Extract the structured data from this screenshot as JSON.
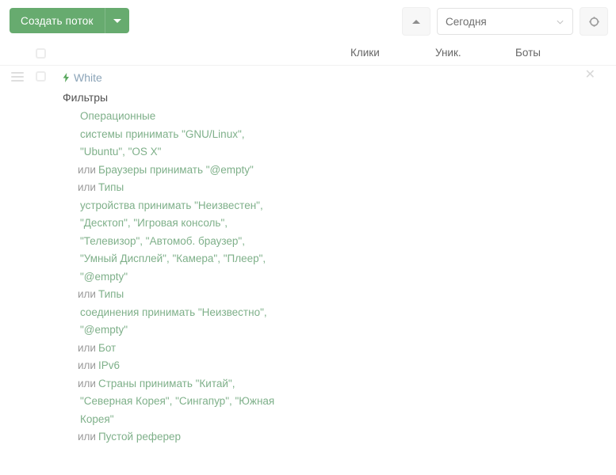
{
  "toolbar": {
    "create_button_label": "Создать поток",
    "create_button_caret_icon": "chevron-down-icon",
    "collapse_button_icon": "chevron-up-icon",
    "refresh_button_icon": "refresh-icon",
    "date_filter": {
      "selected": "Сегодня",
      "chevron_icon": "chevron-down-icon"
    }
  },
  "table": {
    "select_all_checkbox": "unchecked",
    "columns": [
      {
        "label": "Клики"
      },
      {
        "label": "Уник."
      },
      {
        "label": "Боты"
      }
    ]
  },
  "row": {
    "drag_handle_icon": "drag-handle-icon",
    "checkbox": "unchecked",
    "close_icon": "close-icon",
    "stream_icon": "bolt-icon",
    "stream_name": "White",
    "filters_label": "Фильтры",
    "filter_lines": [
      {
        "or": "",
        "text": "Операционные"
      },
      {
        "or": "",
        "text": "системы принимать \"GNU/Linux\","
      },
      {
        "or": "",
        "text": "\"Ubuntu\", \"OS X\""
      },
      {
        "or": "или",
        "text": "Браузеры принимать \"@empty\""
      },
      {
        "or": "или",
        "text": "Типы"
      },
      {
        "or": "",
        "text": "устройства принимать \"Неизвестен\","
      },
      {
        "or": "",
        "text": "\"Десктоп\", \"Игровая консоль\","
      },
      {
        "or": "",
        "text": "\"Телевизор\", \"Автомоб. браузер\","
      },
      {
        "or": "",
        "text": "\"Умный Дисплей\", \"Камера\", \"Плеер\","
      },
      {
        "or": "",
        "text": "\"@empty\""
      },
      {
        "or": "или",
        "text": "Типы"
      },
      {
        "or": "",
        "text": "соединения принимать \"Неизвестно\","
      },
      {
        "or": "",
        "text": "\"@empty\""
      },
      {
        "or": "или",
        "text": "Бот"
      },
      {
        "or": "или",
        "text": "IPv6"
      },
      {
        "or": "или",
        "text": "Страны принимать \"Китай\","
      },
      {
        "or": "",
        "text": "\"Северная Корея\", \"Сингапур\", \"Южная"
      },
      {
        "or": "",
        "text": "Корея\""
      },
      {
        "or": "или",
        "text": "Пустой реферер"
      }
    ]
  },
  "colors": {
    "accent_green": "#67ab6f",
    "filter_text_green": "#7fb08a",
    "link_blue_grey": "#8ba4b8"
  }
}
